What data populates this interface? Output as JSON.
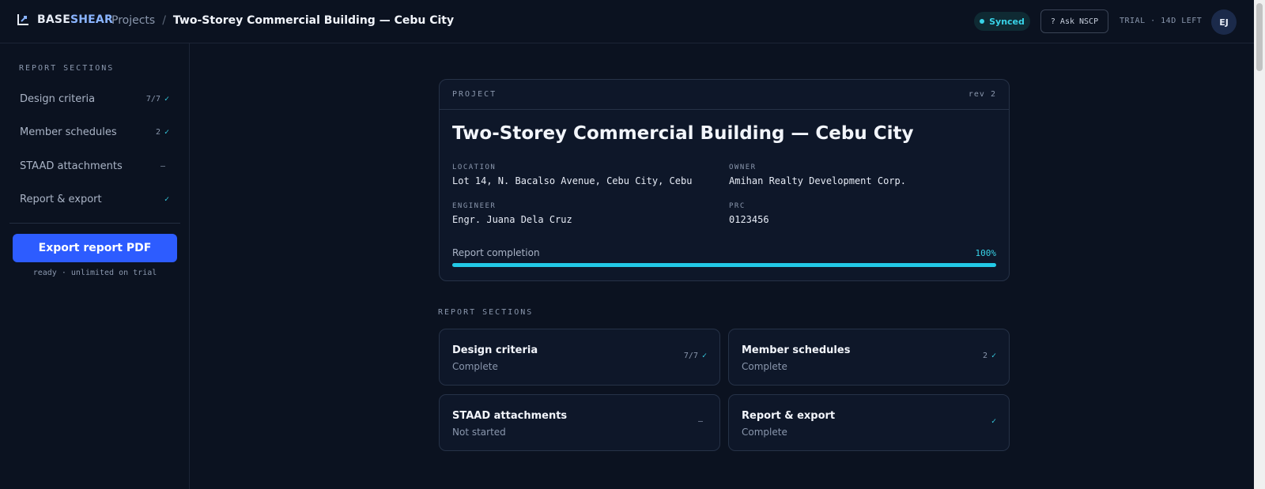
{
  "brand": {
    "name_a": "BASE",
    "name_b": "SHEAR"
  },
  "breadcrumb": {
    "projects": "Projects",
    "separator": "/",
    "current": "Two-Storey Commercial Building — Cebu City"
  },
  "header": {
    "sync_status": "Synced",
    "ask_button": "? Ask NSCP",
    "trial": "TRIAL · 14D LEFT",
    "avatar_initials": "EJ"
  },
  "sidebar": {
    "heading": "REPORT SECTIONS",
    "items": [
      {
        "label": "Design criteria",
        "status": "7/7",
        "check": "✓"
      },
      {
        "label": "Member schedules",
        "status": "2",
        "check": "✓"
      },
      {
        "label": "STAAD attachments",
        "status": "–",
        "check": ""
      },
      {
        "label": "Report & export",
        "status": "",
        "check": "✓"
      }
    ],
    "export_button": "Export report PDF",
    "export_note": "ready · unlimited on trial"
  },
  "project": {
    "kicker": "PROJECT",
    "revision": "rev 2",
    "title": "Two-Storey Commercial Building — Cebu City",
    "location_label": "LOCATION",
    "location": "Lot 14, N. Bacalso Avenue, Cebu City, Cebu",
    "owner_label": "OWNER",
    "owner": "Amihan Realty Development Corp.",
    "engineer_label": "ENGINEER",
    "engineer": "Engr. Juana Dela Cruz",
    "prc_label": "PRC",
    "prc": "0123456",
    "completion_label": "Report completion",
    "completion_pct": "100%",
    "completion_fraction": 1.0
  },
  "sections": {
    "heading": "REPORT SECTIONS",
    "cards": [
      {
        "title": "Design criteria",
        "subtitle": "Complete",
        "status": "7/7",
        "check": "✓"
      },
      {
        "title": "Member schedules",
        "subtitle": "Complete",
        "status": "2",
        "check": "✓"
      },
      {
        "title": "STAAD attachments",
        "subtitle": "Not started",
        "status": "–",
        "check": ""
      },
      {
        "title": "Report & export",
        "subtitle": "Complete",
        "status": "",
        "check": "✓"
      }
    ]
  },
  "colors": {
    "accent": "#38d3e8",
    "primary": "#2d5cff",
    "background": "#0b1220"
  }
}
